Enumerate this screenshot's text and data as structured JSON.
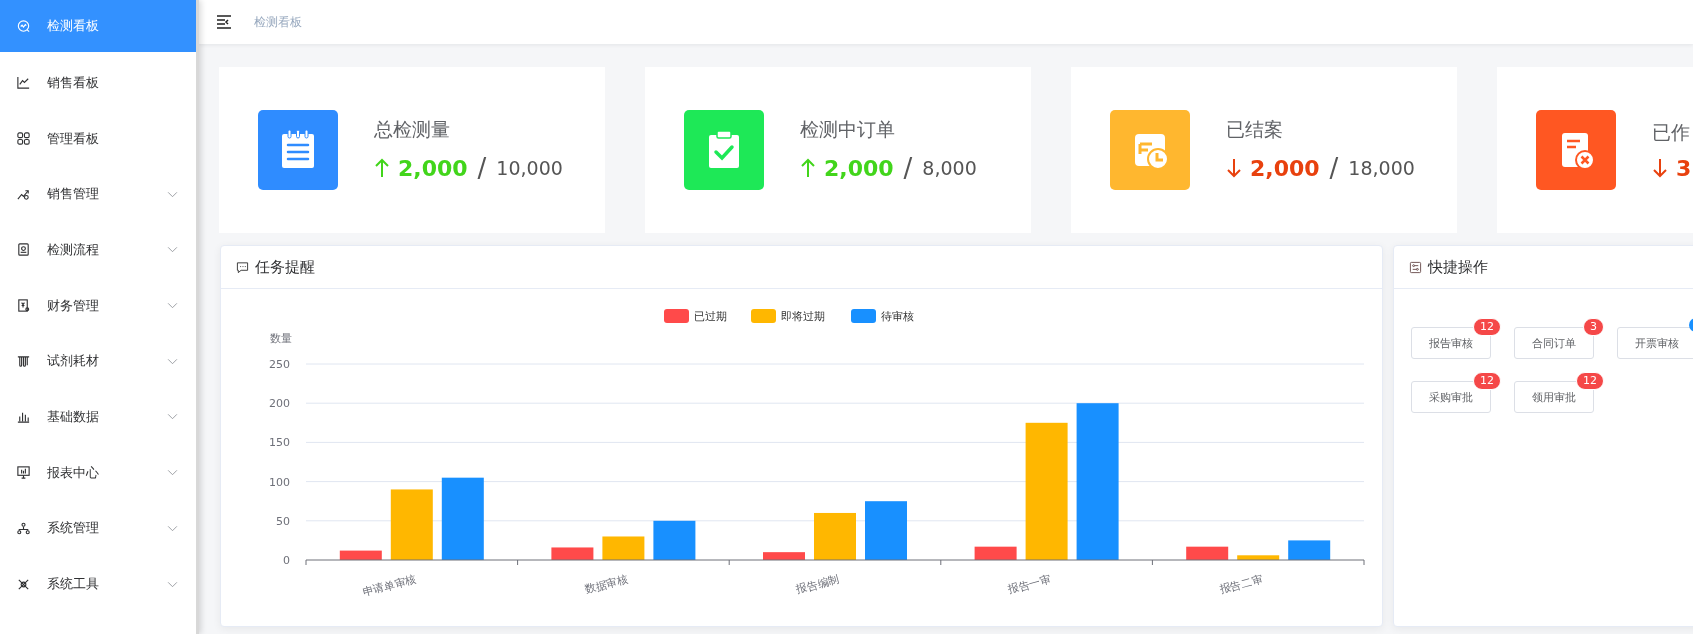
{
  "sidebar": {
    "items": [
      {
        "label": "检测看板",
        "selected": true,
        "expandable": false
      },
      {
        "label": "销售看板",
        "selected": false,
        "expandable": false
      },
      {
        "label": "管理看板",
        "selected": false,
        "expandable": false
      },
      {
        "label": "销售管理",
        "selected": false,
        "expandable": true
      },
      {
        "label": "检测流程",
        "selected": false,
        "expandable": true
      },
      {
        "label": "财务管理",
        "selected": false,
        "expandable": true
      },
      {
        "label": "试剂耗材",
        "selected": false,
        "expandable": true
      },
      {
        "label": "基础数据",
        "selected": false,
        "expandable": true
      },
      {
        "label": "报表中心",
        "selected": false,
        "expandable": true
      },
      {
        "label": "系统管理",
        "selected": false,
        "expandable": true
      },
      {
        "label": "系统工具",
        "selected": false,
        "expandable": true
      }
    ]
  },
  "header": {
    "breadcrumb": "检测看板"
  },
  "stats": [
    {
      "title": "总检测量",
      "color": "#2f8cff",
      "kind": "up",
      "value": "2,000",
      "separator": "/",
      "total": "10,000"
    },
    {
      "title": "检测中订单",
      "color": "#1ee857",
      "kind": "up",
      "value": "2,000",
      "separator": "/",
      "total": "8,000"
    },
    {
      "title": "已结案",
      "color": "#ffb72f",
      "kind": "down",
      "value": "2,000",
      "separator": "/",
      "total": "18,000"
    },
    {
      "title": "已作",
      "color": "#ff5722",
      "kind": "down",
      "value": "3"
    }
  ],
  "tasks": {
    "title": "任务提醒",
    "chart_data": {
      "type": "bar",
      "ylabel": "数量",
      "grid": true,
      "legend": true,
      "categories": [
        "申请单审核",
        "数据审核",
        "报告编制",
        "报告一审",
        "报告二审"
      ],
      "ylim": [
        0,
        250
      ],
      "yticks": [
        0,
        50,
        100,
        150,
        200,
        250
      ],
      "series": [
        {
          "name": "已过期",
          "color": "#ff4a4a",
          "values": [
            12,
            16,
            10,
            17,
            17
          ]
        },
        {
          "name": "即将过期",
          "color": "#ffb700",
          "values": [
            90,
            30,
            60,
            175,
            6
          ]
        },
        {
          "name": "待审核",
          "color": "#1890ff",
          "values": [
            105,
            50,
            75,
            200,
            25
          ]
        }
      ]
    }
  },
  "quick": {
    "title": "快捷操作",
    "buttons": [
      {
        "label": "报告审核",
        "badge": "12",
        "color": "#f54848"
      },
      {
        "label": "合同订单",
        "badge": "3",
        "color": "#f54848"
      },
      {
        "label": "开票审核",
        "color": "#1890ff"
      },
      {
        "label": "采购审批",
        "badge": "12",
        "color": "#f54848"
      },
      {
        "label": "领用审批",
        "badge": "12",
        "color": "#f54848"
      }
    ]
  }
}
